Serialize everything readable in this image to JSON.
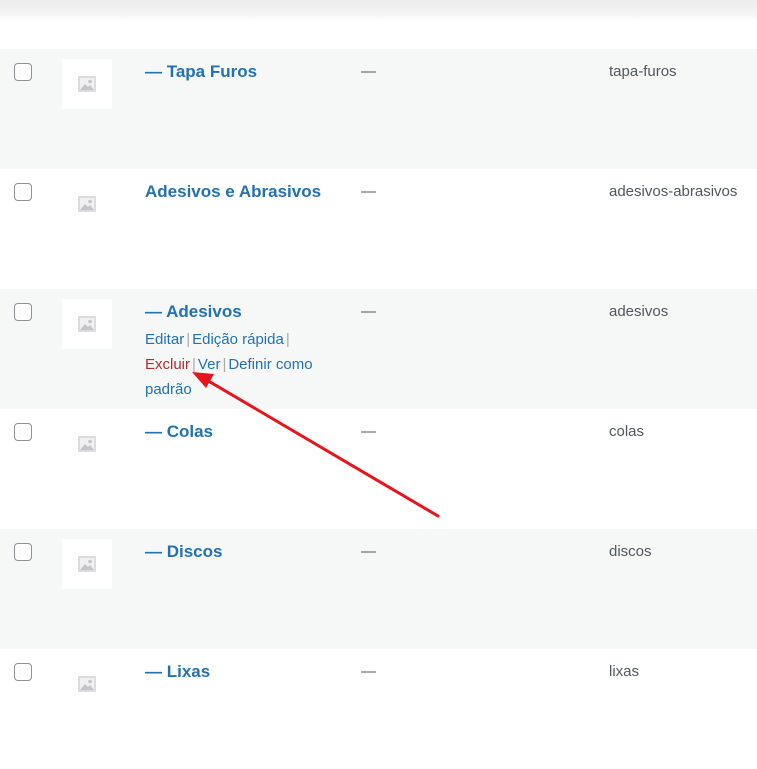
{
  "rows": [
    {
      "name": "— Tapa Furos",
      "description": "—",
      "slug": "tapa-furos"
    },
    {
      "name": "Adesivos e Abrasivos",
      "description": "—",
      "slug": "adesivos-abrasivos"
    },
    {
      "name": "— Adesivos",
      "description": "—",
      "slug": "adesivos"
    },
    {
      "name": "— Colas",
      "description": "—",
      "slug": "colas"
    },
    {
      "name": "— Discos",
      "description": "—",
      "slug": "discos"
    },
    {
      "name": "— Lixas",
      "description": "—",
      "slug": "lixas"
    }
  ],
  "row_actions": {
    "edit": "Editar",
    "quick_edit": "Edição rápida",
    "delete": "Excluir",
    "view": "Ver",
    "make_default": "Definir como padrão",
    "separator": "|"
  },
  "icons": {
    "thumbnail": "placeholder-image-icon",
    "annotation": "red-arrow"
  },
  "colors": {
    "link": "#2271b1",
    "delete": "#b32d2e",
    "row_alt": "#f6f7f7",
    "arrow": "#e8141b"
  }
}
